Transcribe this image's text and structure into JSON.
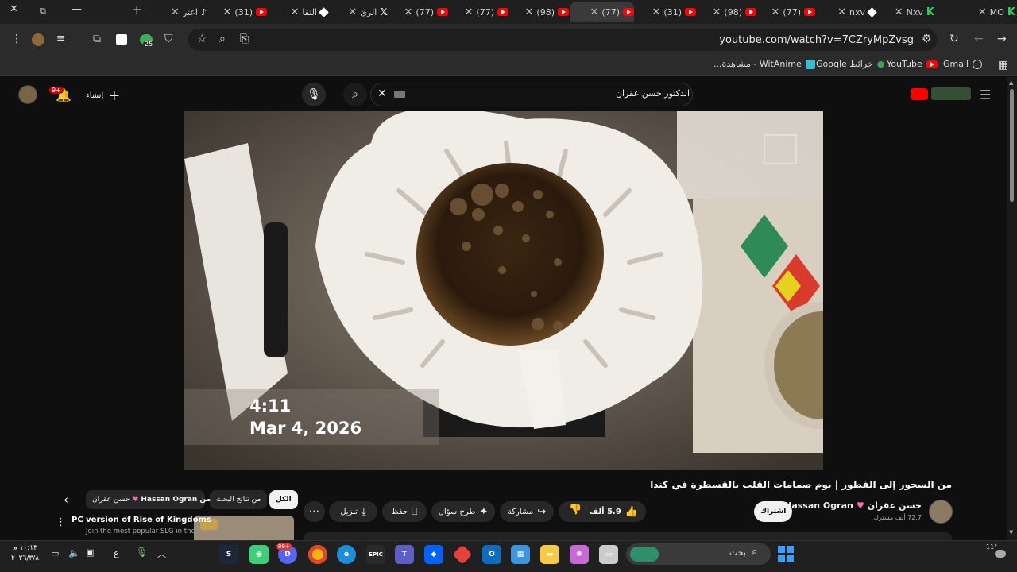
{
  "browser": {
    "tabs": [
      {
        "title": "MO",
        "icon": "k-icon"
      },
      {
        "title": "Nxv",
        "icon": "k-icon"
      },
      {
        "title": "nxv",
        "icon": "diamond-icon"
      },
      {
        "title": "(77)",
        "icon": "youtube-icon"
      },
      {
        "title": "(98)",
        "icon": "youtube-icon"
      },
      {
        "title": "(31)",
        "icon": "youtube-icon"
      },
      {
        "title": "(77)",
        "icon": "youtube-icon",
        "active": true
      },
      {
        "title": "(98)",
        "icon": "youtube-icon"
      },
      {
        "title": "(77)",
        "icon": "youtube-icon"
      },
      {
        "title": "(77)",
        "icon": "youtube-icon"
      },
      {
        "title": "الرئ",
        "icon": "x-logo-icon"
      },
      {
        "title": "التقا",
        "icon": "diamond-icon"
      },
      {
        "title": "(31)",
        "icon": "youtube-icon"
      },
      {
        "title": "اعتر",
        "icon": "tiktok-icon"
      }
    ],
    "url": "youtube.com/watch?v=7CZryMpZvsg",
    "bookmarks": [
      {
        "label": "Gmail"
      },
      {
        "label": "YouTube"
      },
      {
        "label": "خرائط Google"
      },
      {
        "label": "WitAnime - مشاهدة..."
      }
    ],
    "notification_count": "25"
  },
  "youtube": {
    "search_query": "الدكتور حسن عقران",
    "create_label": "إنشاء",
    "notif_badge": "9+",
    "video": {
      "overlay_time": "4:11",
      "overlay_date": "Mar 4, 2026"
    },
    "title": "من السحور إلى الفطور | يوم صمامات القلب بالقسطرة في كندا",
    "channel": {
      "name": "حسن عقران",
      "name_en": "Hassan Ogran",
      "subscribers": "72.7 ألف مشترك",
      "subscribe_label": "اشتراك"
    },
    "actions": {
      "likes": "5.9 ألف",
      "share": "مشاركة",
      "ask": "طرح سؤال",
      "save": "حفظ",
      "download": "تنزيل"
    },
    "chips": [
      "الكل",
      "من نتائج البحث",
      "من Hassan Ogran",
      "حسن عقران"
    ],
    "related": {
      "title": "PC version of Rise of Kingdoms",
      "subtitle": "Join the most popular SLG in the"
    }
  },
  "taskbar": {
    "search_placeholder": "بحث",
    "lang": "ع",
    "time": "١٠:١٣ م",
    "date": "٢٠٢٦/٣/٨",
    "badge": "99+"
  },
  "colors": {
    "youtube_red": "#ff0000",
    "chrome_dark": "#1f1f1f",
    "yt_bg": "#0f0f0f"
  }
}
